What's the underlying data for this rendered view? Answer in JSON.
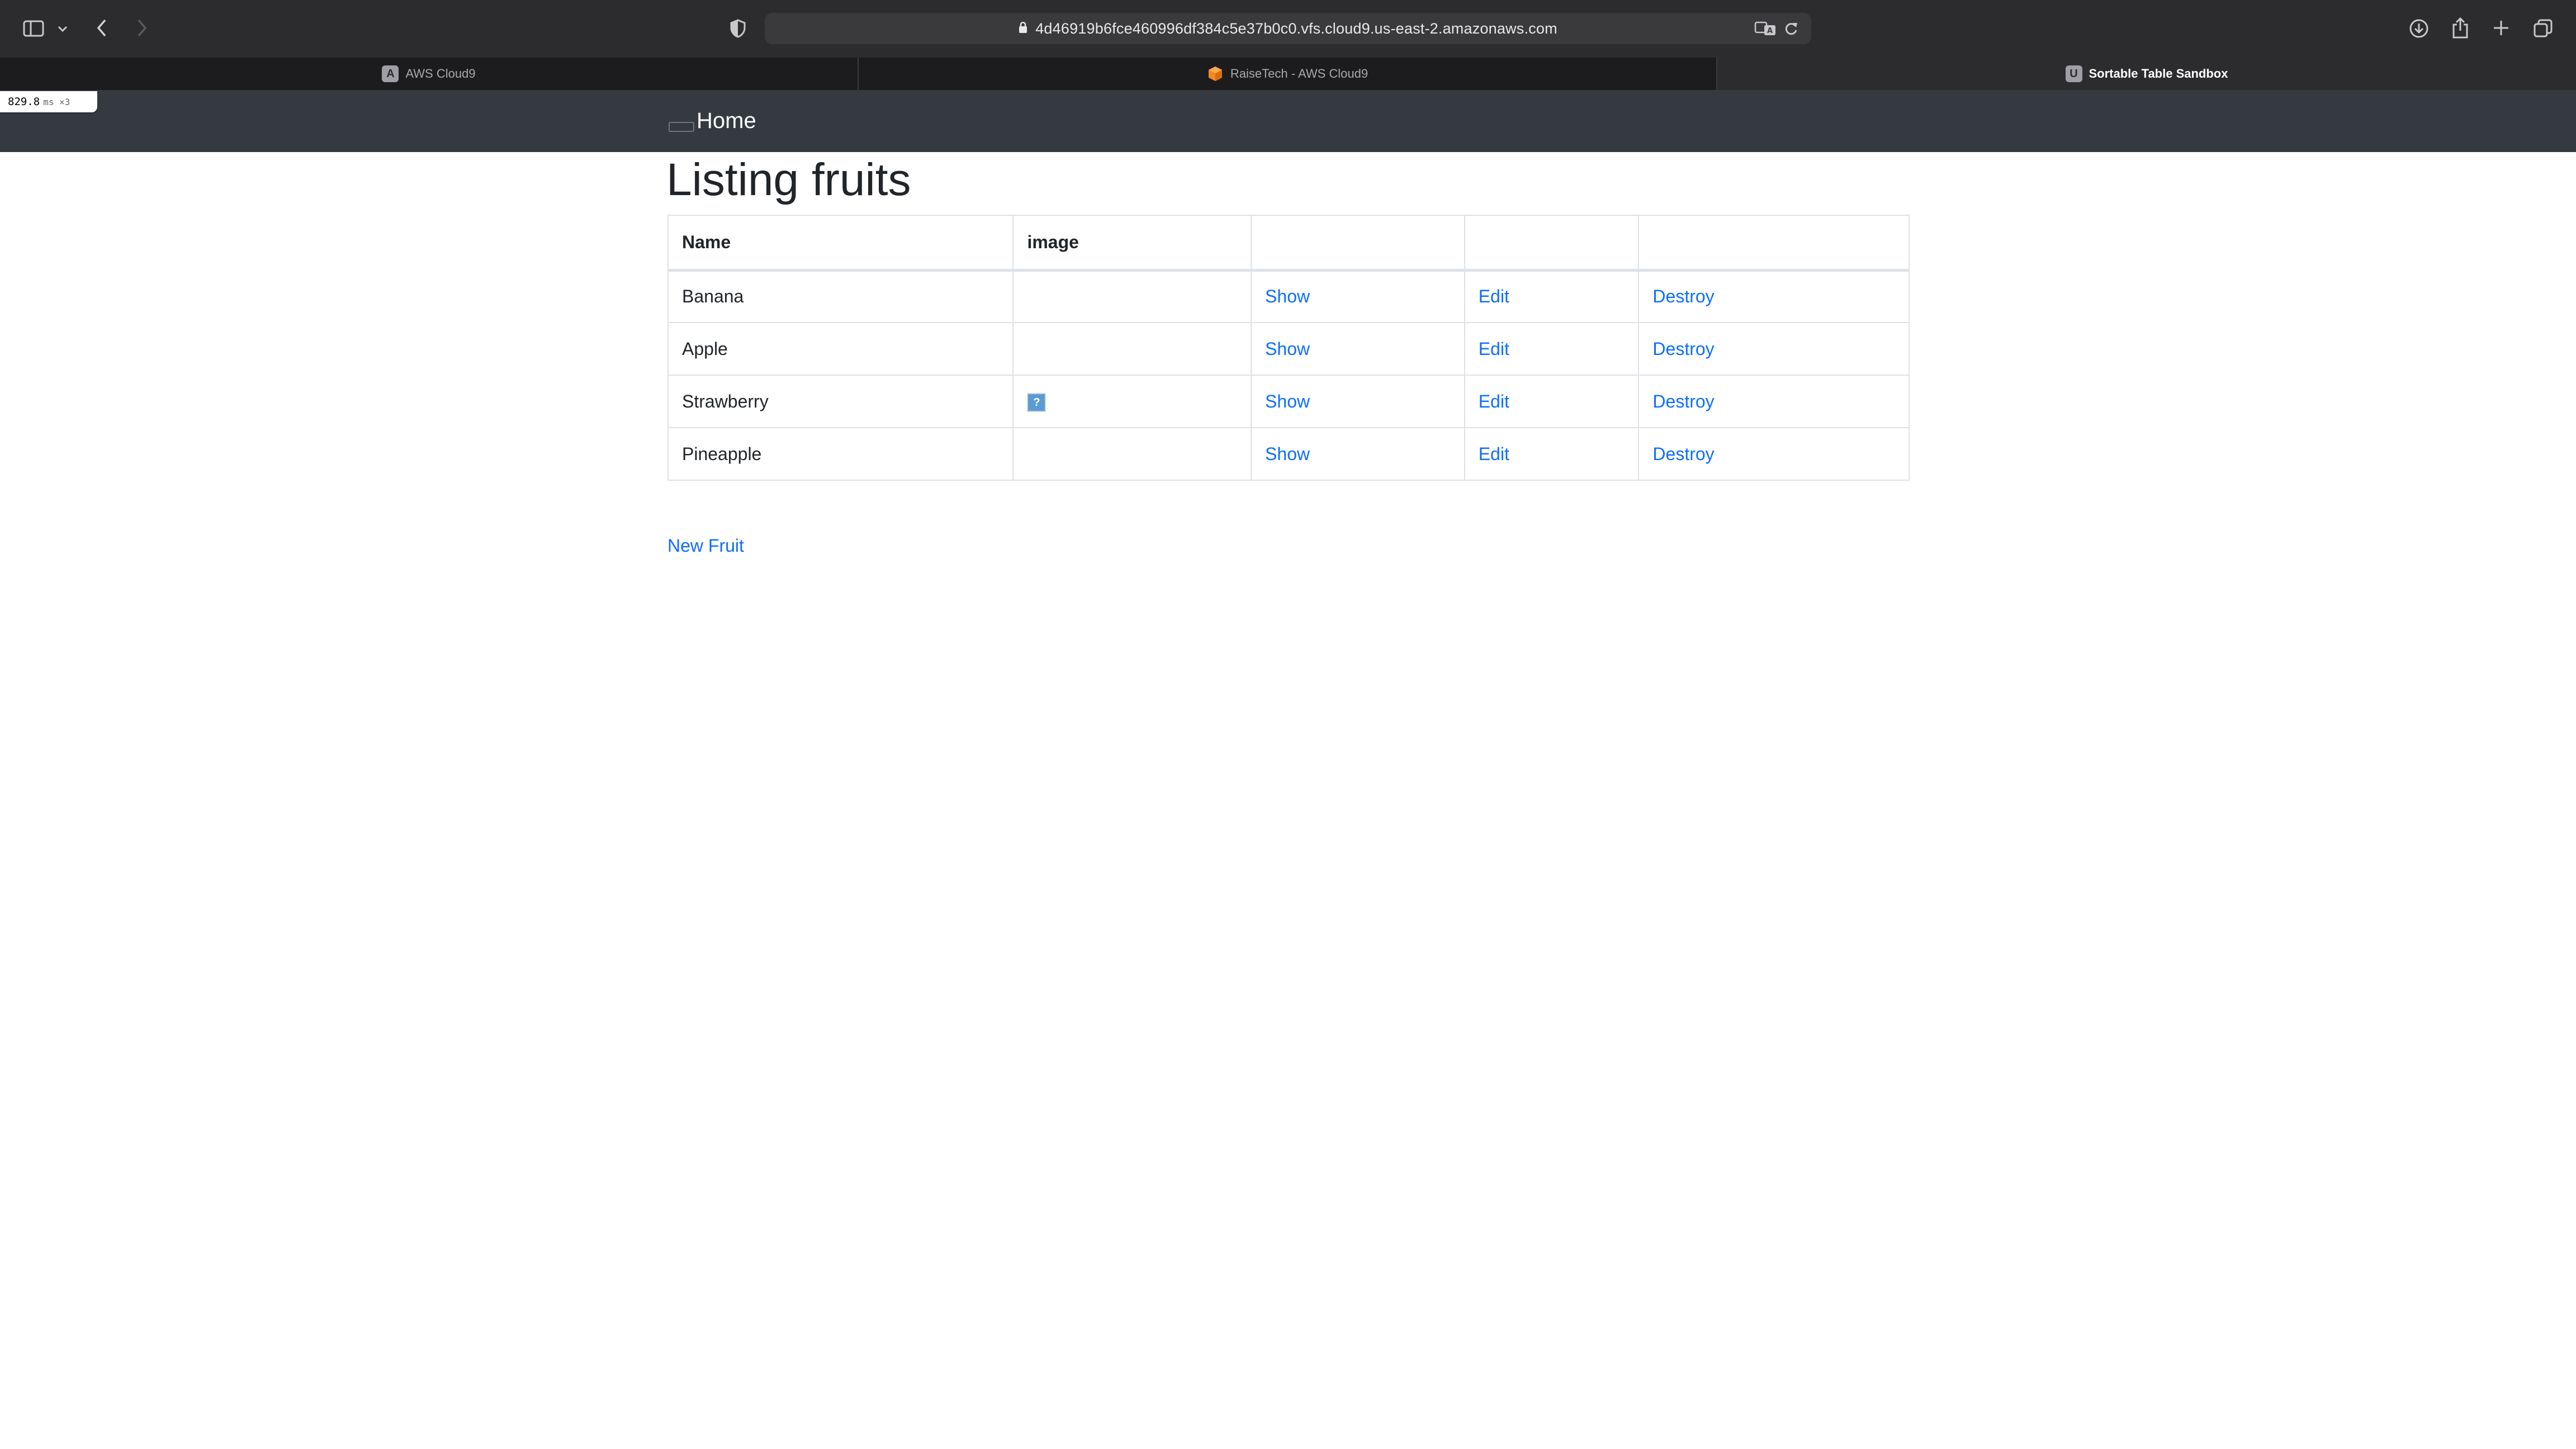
{
  "browser": {
    "url": "4d46919b6fce460996df384c5e37b0c0.vfs.cloud9.us-east-2.amazonaws.com",
    "tabs": [
      {
        "label": "AWS Cloud9",
        "favicon": "A",
        "active": false
      },
      {
        "label": "RaiseTech - AWS Cloud9",
        "favicon": "cube-icon",
        "active": false
      },
      {
        "label": "Sortable Table Sandbox",
        "favicon": "U",
        "active": true
      }
    ]
  },
  "perf": {
    "value": "829.8",
    "unit": "ms ×3"
  },
  "navbar": {
    "home_label": "Home"
  },
  "page": {
    "title": "Listing fruits",
    "new_link": "New Fruit"
  },
  "table": {
    "headers": [
      "Name",
      "image",
      "",
      "",
      ""
    ],
    "rows": [
      {
        "name": "Banana",
        "has_image": false,
        "show": "Show",
        "edit": "Edit",
        "destroy": "Destroy"
      },
      {
        "name": "Apple",
        "has_image": false,
        "show": "Show",
        "edit": "Edit",
        "destroy": "Destroy"
      },
      {
        "name": "Strawberry",
        "has_image": true,
        "image_glyph": "?",
        "show": "Show",
        "edit": "Edit",
        "destroy": "Destroy"
      },
      {
        "name": "Pineapple",
        "has_image": false,
        "show": "Show",
        "edit": "Edit",
        "destroy": "Destroy"
      }
    ]
  },
  "colors": {
    "link": "#0d6efd",
    "navbar": "#343a40",
    "chrome": "#2c2c2e"
  }
}
